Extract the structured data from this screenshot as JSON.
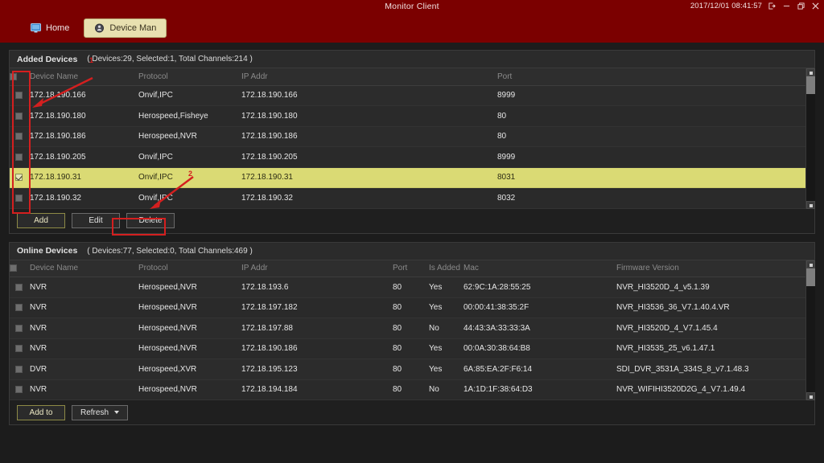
{
  "window": {
    "title": "Monitor Client",
    "clock": "2017/12/01 08:41:57",
    "controls": [
      {
        "name": "logout-icon",
        "label": "Logout"
      },
      {
        "name": "minimize-icon",
        "label": "Minimize"
      },
      {
        "name": "restore-icon",
        "label": "Restore"
      },
      {
        "name": "close-icon",
        "label": "Close"
      }
    ]
  },
  "tabs": [
    {
      "label": "Home",
      "icon": "monitor-icon",
      "active": false
    },
    {
      "label": "Device Man",
      "icon": "device-icon",
      "active": true
    }
  ],
  "added_devices": {
    "title": "Added Devices",
    "stats": "( Devices:29, Selected:1, Total Channels:214 )",
    "columns": [
      "Device Name",
      "Protocol",
      "IP Addr",
      "Port"
    ],
    "rows": [
      {
        "name": "172.18.190.166",
        "protocol": "Onvif,IPC",
        "ip": "172.18.190.166",
        "port": "8999",
        "checked": false,
        "selected": false
      },
      {
        "name": "172.18.190.180",
        "protocol": "Herospeed,Fisheye",
        "ip": "172.18.190.180",
        "port": "80",
        "checked": false,
        "selected": false
      },
      {
        "name": "172.18.190.186",
        "protocol": "Herospeed,NVR",
        "ip": "172.18.190.186",
        "port": "80",
        "checked": false,
        "selected": false
      },
      {
        "name": "172.18.190.205",
        "protocol": "Onvif,IPC",
        "ip": "172.18.190.205",
        "port": "8999",
        "checked": false,
        "selected": false
      },
      {
        "name": "172.18.190.31",
        "protocol": "Onvif,IPC",
        "ip": "172.18.190.31",
        "port": "8031",
        "checked": true,
        "selected": true
      },
      {
        "name": "172.18.190.32",
        "protocol": "Onvif,IPC",
        "ip": "172.18.190.32",
        "port": "8032",
        "checked": false,
        "selected": false
      }
    ],
    "buttons": [
      {
        "label": "Add",
        "style": "olive"
      },
      {
        "label": "Edit",
        "style": "plain"
      },
      {
        "label": "Delete",
        "style": "plain",
        "highlighted": true
      }
    ]
  },
  "online_devices": {
    "title": "Online Devices",
    "stats": "( Devices:77, Selected:0, Total Channels:469 )",
    "columns": [
      "Device Name",
      "Protocol",
      "IP Addr",
      "Port",
      "Is Added",
      "Mac",
      "Firmware Version"
    ],
    "rows": [
      {
        "name": "NVR",
        "protocol": "Herospeed,NVR",
        "ip": "172.18.193.6",
        "port": "80",
        "is_added": "Yes",
        "mac": "62:9C:1A:28:55:25",
        "firmware": "NVR_HI3520D_4_v5.1.39"
      },
      {
        "name": "NVR",
        "protocol": "Herospeed,NVR",
        "ip": "172.18.197.182",
        "port": "80",
        "is_added": "Yes",
        "mac": "00:00:41:38:35:2F",
        "firmware": "NVR_HI3536_36_V7.1.40.4.VR"
      },
      {
        "name": "NVR",
        "protocol": "Herospeed,NVR",
        "ip": "172.18.197.88",
        "port": "80",
        "is_added": "No",
        "mac": "44:43:3A:33:33:3A",
        "firmware": "NVR_HI3520D_4_V7.1.45.4"
      },
      {
        "name": "NVR",
        "protocol": "Herospeed,NVR",
        "ip": "172.18.190.186",
        "port": "80",
        "is_added": "Yes",
        "mac": "00:0A:30:38:64:B8",
        "firmware": "NVR_HI3535_25_v6.1.47.1"
      },
      {
        "name": "DVR",
        "protocol": "Herospeed,XVR",
        "ip": "172.18.195.123",
        "port": "80",
        "is_added": "Yes",
        "mac": "6A:85:EA:2F:F6:14",
        "firmware": "SDI_DVR_3531A_334S_8_v7.1.48.3"
      },
      {
        "name": "NVR",
        "protocol": "Herospeed,NVR",
        "ip": "172.18.194.184",
        "port": "80",
        "is_added": "No",
        "mac": "1A:1D:1F:38:64:D3",
        "firmware": "NVR_WIFIHI3520D2G_4_V7.1.49.4"
      }
    ],
    "buttons": [
      {
        "label": "Add to",
        "style": "olive"
      },
      {
        "label": "Refresh",
        "style": "plain",
        "caret": true
      }
    ]
  },
  "annotations": {
    "step1": "1",
    "step2": "2"
  },
  "colors": {
    "header_red": "#7b0000",
    "selected_row": "#dada74",
    "annotation_red": "#d41f1f",
    "panel_bg": "#2b2b2b",
    "app_bg": "#1c1c1c"
  }
}
